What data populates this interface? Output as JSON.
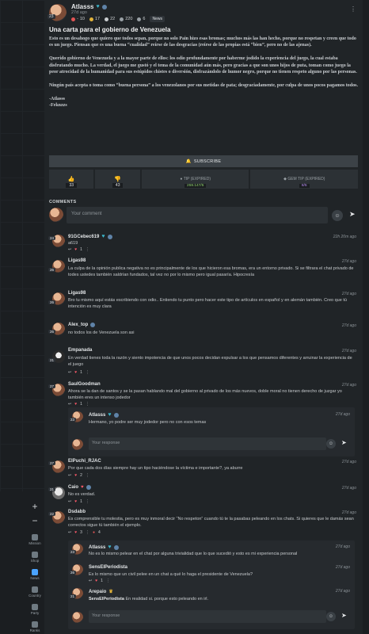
{
  "nav": {
    "zoom_in": "+",
    "zoom_out": "−",
    "items": [
      {
        "label": "Mission",
        "icon": "mission-icon"
      },
      {
        "label": "Shop",
        "icon": "shop-icon"
      },
      {
        "label": "News",
        "icon": "news-icon",
        "active": true
      },
      {
        "label": "Country",
        "icon": "country-icon"
      },
      {
        "label": "Party",
        "icon": "party-icon"
      },
      {
        "label": "Ranks",
        "icon": "ranks-icon"
      }
    ]
  },
  "post": {
    "author": "Atlasss",
    "level": "23",
    "time": "27d ago",
    "stats": {
      "votes": "10",
      "gold": "17",
      "comments": "22",
      "views": "220",
      "shares": "6"
    },
    "category": "News",
    "title": "Una carta para el gobierno de Venezuela",
    "paragraphs": [
      "Esto es un desahogo que quiero que todos sepan, porque no solo Pain hizo esas bromas; muchos más las han hecho, porque no respetan y creen que todo es un juego. Piensan que es una buena “cualidad” reírse de las desgracias (reírse de las propias está “bien”, pero no de las ajenas).",
      "Querido gobierno de Venezuela y a la mayor parte de ellos: los odio profundamente por haberme jodido la experiencia del juego, la cual estaba disfrutando mucho. La verdad, el juego me gustó y el tema de la comunidad aún más, pero gracias a que son unos hijos de puta, toman como juego la peor atrocidad de la humanidad para sus estúpidos chistes o diversión, disfrazándolo de humor negro, porque no tienen respeto alguno por las personas.",
      "Ningún país acepta o toma como “buena persona” a los venezolanos por sus metidas de pata; desgraciadamente, por culpa de unos pocos pagamos todos.",
      "-Atlasss\n-Feknzzs"
    ],
    "subscribe_label": "SUBSCRIBE",
    "upvotes": "33",
    "downvotes": "43",
    "tip_label": "TIP (EXPIRED)",
    "tip_value": "259.147/5",
    "gem_tip_label": "GEM TIP (EXPIRED)",
    "gem_tip_value": "8/5"
  },
  "comments_section": {
    "label": "COMMENTS",
    "placeholder": "Your comment",
    "reply_placeholder": "Your response"
  },
  "comments": [
    {
      "user": "91GCebec619",
      "level": "24",
      "time": "22h 20m ago",
      "text": "a619",
      "likes": "1"
    },
    {
      "user": "Ligas98",
      "level": "26",
      "time": "27d ago",
      "text": "La culpa de la opinión publica negativa no es principalmente de los que hicieron esa bromas, era un entorno privado. Si se filtrara el chat privado de todes ustedes también saldrían fundados, tal vez no por lo mismo pero igual pasaría. Hipocresía"
    },
    {
      "user": "Ligas98",
      "level": "26",
      "time": "27d ago",
      "text": "Bro tu mismo aquí estás escribiendo con odio.. Entiendo tu punto pero hacer este tipo de artículos en español y en alemán también. Creo que tú intención es muy clara"
    },
    {
      "user": "Alex_top",
      "level": "26",
      "time": "27d ago",
      "text": "no todos los de Venezuela son asi"
    },
    {
      "user": "Empanada",
      "level": "21",
      "time": "27d ago",
      "text": "En verdad tienes toda la razón y siento impotencia de que unos pocos decidan expulsar a los que pensamos diferentes y arruinar la experiencia de el juego",
      "likes": "1"
    },
    {
      "user": "SaulGoodman",
      "level": "27",
      "time": "27d ago",
      "text": "Ahora se la dan de santos y se la pasan hablando mal del gobierno al privado de los más nuevos, doble moral no tienen derecho de juzgar yo también eres un intenso jodedor",
      "likes": "1"
    },
    {
      "user": "Atlasss",
      "level": "23",
      "time": "27d ago",
      "text": "Hermano, yo podre ser muy jodedor pero no con esos temas"
    },
    {
      "user": "ElPuchi_RJAC",
      "level": "27",
      "time": "27d ago",
      "text": "Por que cada dos días siempre hay un tipo haciéndose la víctima e importante?, ya aburre",
      "likes": "2"
    },
    {
      "user": "Caio",
      "level": "21",
      "time": "27d ago",
      "text": "No es verdad.",
      "likes": "1"
    },
    {
      "user": "Dsdabb",
      "level": "22",
      "time": "27d ago",
      "text": "Es comprensible tu molestia, pero es muy inmoral decir “No respeton” cuando tú te la pasabas peleando en los chats. Si quieres que le damás sean correctos sigue tú también el ejemplo.",
      "likes": "3",
      "extra": "4"
    },
    {
      "user": "Atlasss",
      "level": "23",
      "time": "27d ago",
      "text": "No es lo mismo pelear en el chat por alguna trivialidad que lo que sucedió y esto es mi experiencia personal"
    },
    {
      "user": "SensElPeriodista",
      "level": "26",
      "time": "27d ago",
      "text": "Es lo mismo que un civil pelee en un chat a qué lo haga el presidente de Venezuela?",
      "likes": "1"
    },
    {
      "user": "Arepaio",
      "level": "21",
      "time": "27d ago",
      "mention": "SensElPeriodista",
      "text": "En realidad si. porque esto peleando en irl."
    }
  ],
  "colors": {
    "accent": "#4aa3ff",
    "heart": "#3ab5c9",
    "tip": "#8fd16a",
    "gem": "#b58cf0",
    "like": "#ff5a6a"
  }
}
